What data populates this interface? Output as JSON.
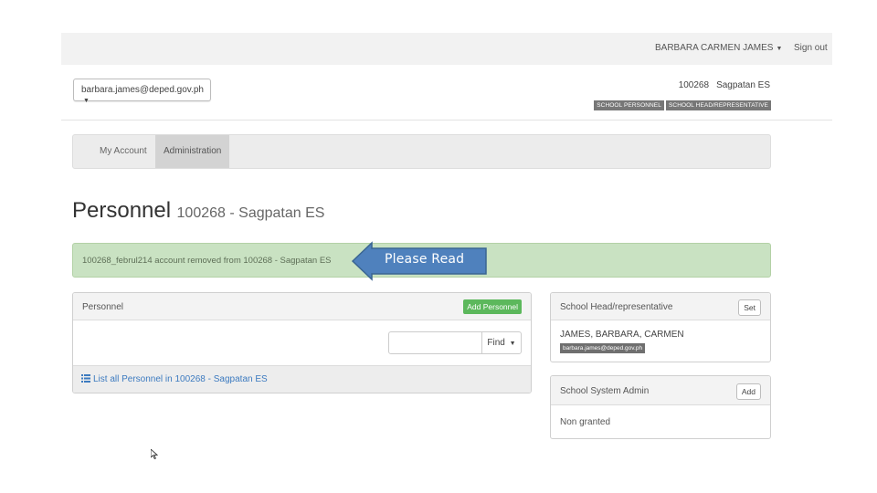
{
  "topbar": {
    "user_name": "BARBARA CARMEN JAMES",
    "signout_label": "Sign out"
  },
  "header": {
    "account_email": "barbara.james@deped.gov.ph",
    "school_id": "100268",
    "school_name": "Sagpatan ES",
    "roles": [
      "SCHOOL PERSONNEL",
      "SCHOOL HEAD/REPRESENTATIVE"
    ]
  },
  "nav": {
    "items": [
      {
        "label": "My Account",
        "active": false
      },
      {
        "label": "Administration",
        "active": true
      }
    ]
  },
  "page": {
    "title": "Personnel",
    "subtitle": "100268 - Sagpatan ES"
  },
  "alert": {
    "message": "100268_februl214 account removed from 100268 - Sagpatan ES"
  },
  "callout": {
    "label": "Please Read",
    "color": "#4f81bd"
  },
  "personnel_panel": {
    "title": "Personnel",
    "add_button": "Add Personnel",
    "search_value": "",
    "find_label": "Find",
    "list_link": "List all Personnel in 100268 - Sagpatan ES",
    "list_icon": "list-icon"
  },
  "head_panel": {
    "title": "School Head/representative",
    "set_button": "Set",
    "name": "JAMES, BARBARA, CARMEN",
    "email": "barbara.james@deped.gov.ph"
  },
  "admin_panel": {
    "title": "School System Admin",
    "add_button": "Add",
    "status": "Non granted"
  },
  "colors": {
    "success_green": "#5cb85c",
    "alert_bg": "#c9e2c2",
    "link_blue": "#3d7bc0"
  }
}
